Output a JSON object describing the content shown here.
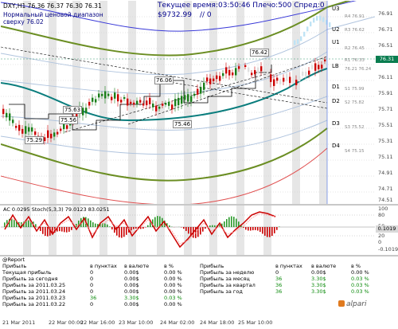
{
  "chart": {
    "header": "DXY,H1  76.36 76.37 76.30 76.31",
    "subtitle1": "Нормальный ценовой диапазон",
    "subtitle2": "сверху 76.02",
    "info_time": "Текущее время:03:50:46 Плечо:500 Спред:0",
    "info_equity": "$9732.99",
    "info_zero": "// 0",
    "current_price": "76.31",
    "price_color": "#0a7d50",
    "labels": {
      "u3": "U3",
      "u2": "U2",
      "u1": "U1",
      "lb": "LB",
      "d1": "D1",
      "d2": "D2",
      "d3": "D3",
      "d4": "D4"
    },
    "levels": {
      "r4": "R4 76.91",
      "r3": "R3 76.62",
      "r2": "R2 76.45",
      "r1": "R1 76.33",
      "pp": "76.21 76.24",
      "s1": "S1 75.99",
      "s2": "S2 75.82",
      "s3": "S3 75.52",
      "s4": "S4 75.15"
    },
    "price_annotations": [
      "76.42",
      "76.06",
      "75.63",
      "75.56",
      "75.29",
      "75.46"
    ],
    "y_ticks": [
      "76.91",
      "76.71",
      "76.51",
      "76.31",
      "76.11",
      "75.91",
      "75.71",
      "75.51",
      "75.31",
      "75.11",
      "74.91",
      "74.71",
      "74.51"
    ]
  },
  "indicator": {
    "header": "AC 0.0295  Stoch(5,3,3) 79.0123 83.0251",
    "ticks": [
      "100",
      "80",
      "50",
      "20",
      "0"
    ],
    "macd_value": "0.1019",
    "macd_low": "-0.1019"
  },
  "report": {
    "title": "@Report",
    "left": {
      "headers": [
        "Прибыль",
        "в пунктах",
        "в валюте",
        "в %"
      ],
      "rows": [
        [
          "Текущая прибыль",
          "0",
          "0.00$",
          "0.00 %"
        ],
        [
          "Прибыль за сегодня",
          "0",
          "0.00$",
          "0.00 %"
        ],
        [
          "Прибыль за 2011.03.25",
          "0",
          "0.00$",
          "0.00 %"
        ],
        [
          "Прибыль за 2011.03.24",
          "0",
          "0.00$",
          "0.00 %"
        ],
        [
          "Прибыль за 2011.03.23",
          "36",
          "3.30$",
          "0.03 %"
        ],
        [
          "Прибыль за 2011.03.22",
          "0",
          "0.00$",
          "0.00 %"
        ]
      ]
    },
    "right": {
      "headers": [
        "Прибыль",
        "в пунктах",
        "в валюте",
        "в %"
      ],
      "rows": [
        [
          "Прибыль за неделю",
          "0",
          "0.00$",
          "0.00 %"
        ],
        [
          "Прибыль за месяц",
          "36",
          "3.30$",
          "0.03 %"
        ],
        [
          "Прибыль за квартал",
          "36",
          "3.30$",
          "0.03 %"
        ],
        [
          "Прибыль за год",
          "36",
          "3.30$",
          "0.03 %"
        ]
      ]
    },
    "logo": "alpari"
  },
  "x_axis": [
    "21 Mar 2011",
    "22 Mar 00:00",
    "22 Mar 16:00",
    "23 Mar 10:00",
    "24 Mar 02:00",
    "24 Mar 18:00",
    "25 Mar 10:00"
  ]
}
